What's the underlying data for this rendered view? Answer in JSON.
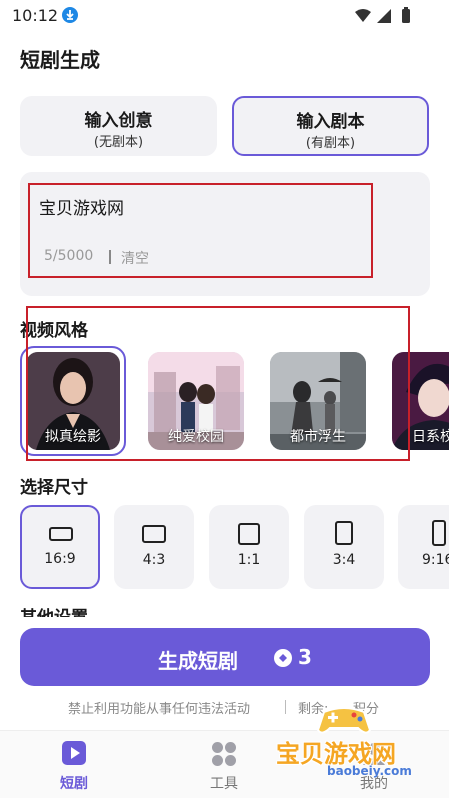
{
  "status_bar": {
    "time": "10:12"
  },
  "page": {
    "title": "短剧生成"
  },
  "modes": [
    {
      "title": "输入创意",
      "subtitle": "(无剧本)"
    },
    {
      "title": "输入剧本",
      "subtitle": "(有剧本)"
    }
  ],
  "script_input": {
    "value": "宝贝游戏网",
    "char_count": "5/5000",
    "clear_label": "清空"
  },
  "video_style": {
    "title": "视频风格",
    "styles": [
      {
        "label": "拟真绘影"
      },
      {
        "label": "纯爱校园"
      },
      {
        "label": "都市浮生"
      },
      {
        "label": "日系校"
      }
    ]
  },
  "size": {
    "title": "选择尺寸",
    "options": [
      {
        "label": "16:9"
      },
      {
        "label": "4:3"
      },
      {
        "label": "1:1"
      },
      {
        "label": "3:4"
      },
      {
        "label": "9:16"
      }
    ]
  },
  "other_settings": {
    "title": "其他设置"
  },
  "generate": {
    "label": "生成短剧",
    "cost": "3"
  },
  "footer": {
    "notice": "禁止利用功能从事任何违法活动",
    "remaining_label": "剩余:",
    "points_label": "积分"
  },
  "nav": [
    {
      "label": "短剧"
    },
    {
      "label": "工具"
    },
    {
      "label": "我的"
    }
  ],
  "watermark": {
    "text": "宝贝游戏网",
    "url": "baobeiy.com"
  },
  "colors": {
    "accent": "#6a5ad8",
    "highlight_box": "#c8202a"
  }
}
